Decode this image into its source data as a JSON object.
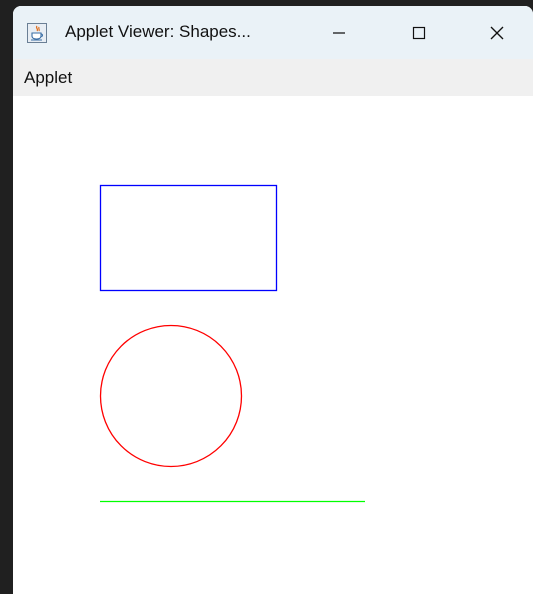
{
  "window": {
    "title": "Applet Viewer: Shapes...",
    "icon": "java-icon",
    "controls": {
      "minimize": "minimize-icon",
      "maximize": "maximize-icon",
      "close": "close-icon"
    }
  },
  "menubar": {
    "items": [
      {
        "label": "Applet"
      }
    ]
  },
  "canvas": {
    "shapes": [
      {
        "type": "rectangle",
        "color": "#0000ff"
      },
      {
        "type": "circle",
        "color": "#ff0000"
      },
      {
        "type": "line",
        "color": "#00ff00"
      }
    ]
  }
}
